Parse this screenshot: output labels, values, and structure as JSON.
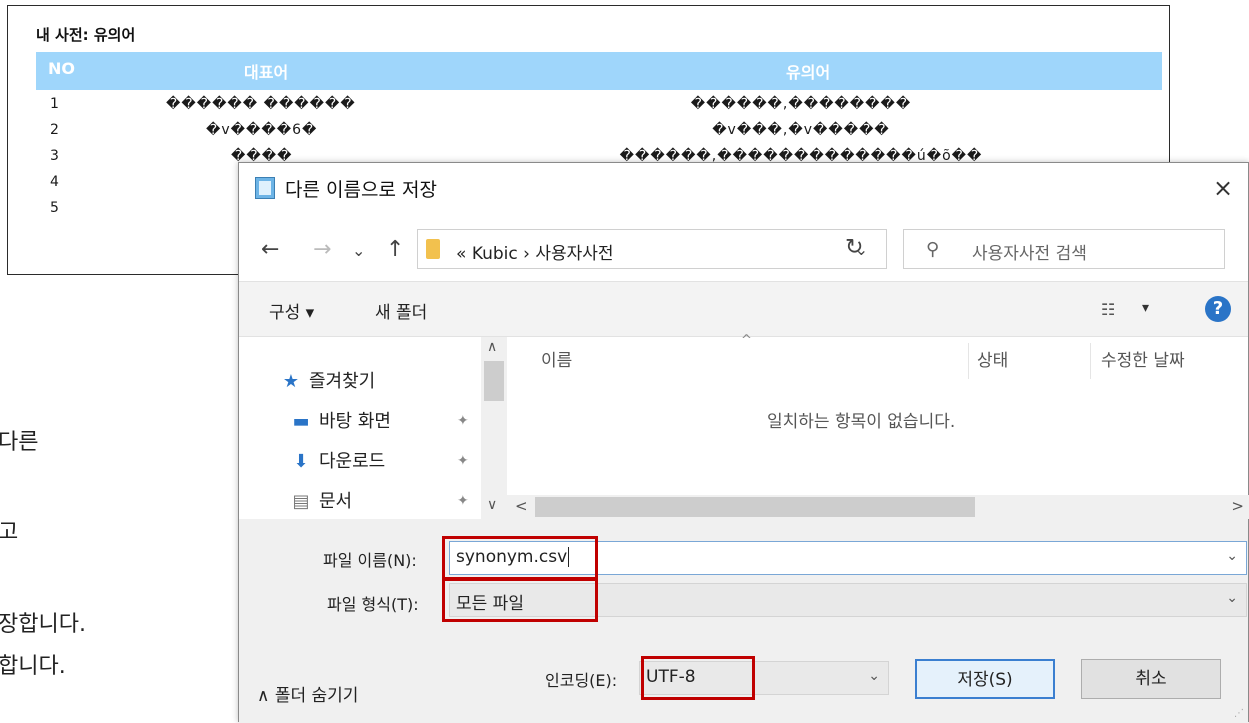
{
  "sheet": {
    "title": "내 사전: 유의어",
    "headers": {
      "no": "NO",
      "rep": "대표어",
      "syn": "유의어"
    },
    "rows": [
      {
        "no": "1",
        "rep": "������ ������",
        "syn": "������,��������"
      },
      {
        "no": "2",
        "rep": "�v����6�",
        "syn": "�v���,�v�����"
      },
      {
        "no": "3",
        "rep": "����",
        "syn": "������,�������������ú�õ��"
      },
      {
        "no": "4",
        "rep": "",
        "syn": ""
      },
      {
        "no": "5",
        "rep": "",
        "syn": ""
      }
    ]
  },
  "side_text": [
    "다른",
    "고",
    "장합니다.",
    "합니다."
  ],
  "dialog": {
    "title": "다른 이름으로 저장",
    "close_icon": "×",
    "nav": {
      "back": "←",
      "forward": "→",
      "recent": "⌄",
      "up": "↑"
    },
    "address": {
      "prefix": "«",
      "path": "Kubic  ›  사용자사전",
      "drop": "⌄"
    },
    "refresh": "↻",
    "search": {
      "icon": "⚲",
      "placeholder": "사용자사전 검색"
    },
    "toolbar": {
      "organize": "구성 ▾",
      "new_folder": "새 폴더",
      "view_icon": "☷",
      "view_drop": "▾",
      "help": "?"
    },
    "nav_items": [
      {
        "icon": "★",
        "label": "즐겨찾기",
        "pinned": false
      },
      {
        "icon": "▬",
        "label": "바탕 화면",
        "pinned": true
      },
      {
        "icon": "⬇",
        "label": "다운로드",
        "pinned": true
      },
      {
        "icon": "▤",
        "label": "문서",
        "pinned": true
      }
    ],
    "pin_icon": "✦",
    "columns": {
      "name": "이름",
      "status": "상태",
      "modified": "수정한 날짜"
    },
    "sort_arrow": "^",
    "empty_message": "일치하는 항목이 없습니다.",
    "filename": {
      "label": "파일 이름(N):",
      "value": "synonym.csv",
      "drop": "⌄"
    },
    "filetype": {
      "label": "파일 형식(T):",
      "value": "모든 파일",
      "drop": "⌄"
    },
    "encoding": {
      "label": "인코딩(E):",
      "value": "UTF-8",
      "drop": "⌄"
    },
    "save_label": "저장(S)",
    "cancel_label": "취소",
    "hide_folders": "∧  폴더 숨기기",
    "scroll": {
      "up": "∧",
      "down": "∨",
      "left": "<",
      "right": ">"
    }
  }
}
